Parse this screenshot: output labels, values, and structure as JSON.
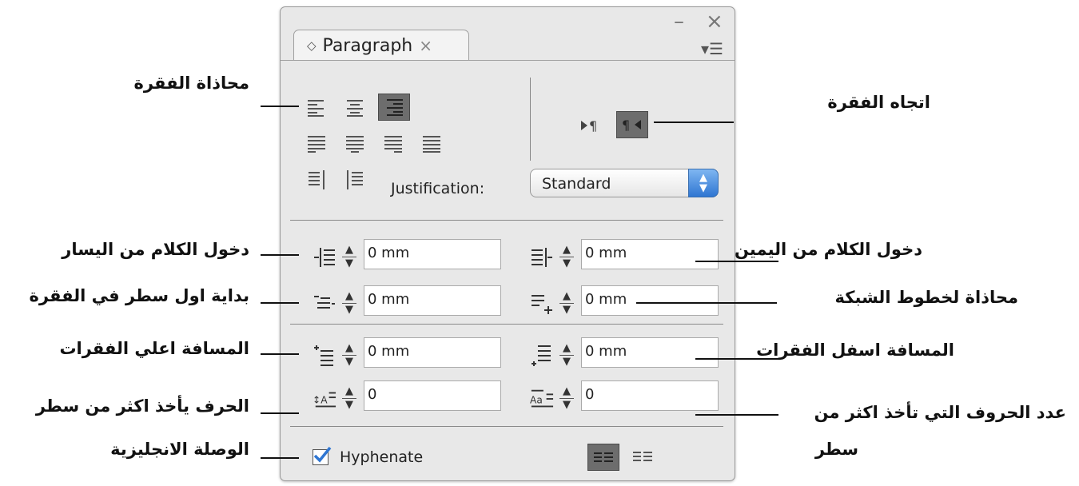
{
  "panel": {
    "tab_title": "Paragraph",
    "tab_arrow": "◇",
    "tab_close": "×",
    "minimize": "–",
    "close": "×",
    "menu": "▾☰",
    "justification_label": "Justification:",
    "justification_value": "Standard",
    "fields": {
      "left_indent": "0 mm",
      "right_indent": "0 mm",
      "first_line_indent": "0 mm",
      "last_line_indent": "0 mm",
      "space_before": "0 mm",
      "space_after": "0 mm",
      "drop_cap_lines": "0",
      "drop_cap_chars": "0"
    },
    "hyphenate_label": "Hyphenate",
    "hyphenate_checked": true
  },
  "annotations": {
    "paragraph_alignment": "محاذاة الفقرة",
    "paragraph_direction": "اتجاه الفقرة",
    "left_indent": "دخول الكلام من اليسار",
    "right_indent": "دخول الكلام من اليمين",
    "first_line_indent": "بداية اول سطر في الفقرة",
    "align_to_grid": "محاذاة لخطوط الشبكة",
    "space_before": "المسافة اعلي الفقرات",
    "space_after": "المسافة اسفل الفقرات",
    "drop_cap_lines": "الحرف يأخذ اكثر من سطر",
    "drop_cap_chars_line1": "عدد الحروف التي تأخذ اكثر من",
    "drop_cap_chars_line2": "سطر",
    "hyphenation": "الوصلة الانجليزية"
  },
  "colors": {
    "panel_bg": "#e8e8e8",
    "selected_icon": "#6d6d6d",
    "checkbox_accent": "#2f76d2",
    "select_arrow": "#2f76d2"
  }
}
